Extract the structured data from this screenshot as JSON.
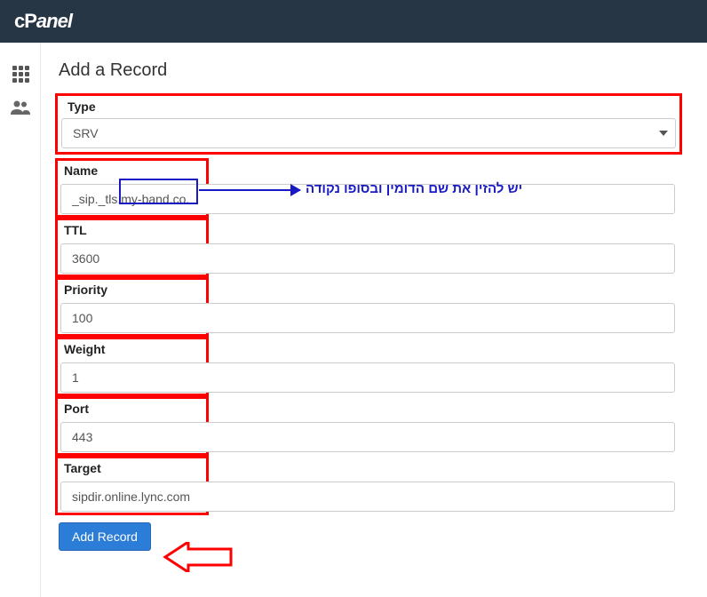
{
  "header": {
    "logo": "cPanel"
  },
  "page": {
    "title": "Add a Record"
  },
  "form": {
    "type": {
      "label": "Type",
      "value": "SRV"
    },
    "name": {
      "label": "Name",
      "value": "_sip._tls.my-band.co."
    },
    "ttl": {
      "label": "TTL",
      "value": "3600"
    },
    "priority": {
      "label": "Priority",
      "value": "100"
    },
    "weight": {
      "label": "Weight",
      "value": "1"
    },
    "port": {
      "label": "Port",
      "value": "443"
    },
    "target": {
      "label": "Target",
      "value": "sipdir.online.lync.com"
    },
    "submit_label": "Add Record"
  },
  "annotation": {
    "hebrew_note": "יש להזין את שם הדומין ובסופו נקודה"
  }
}
